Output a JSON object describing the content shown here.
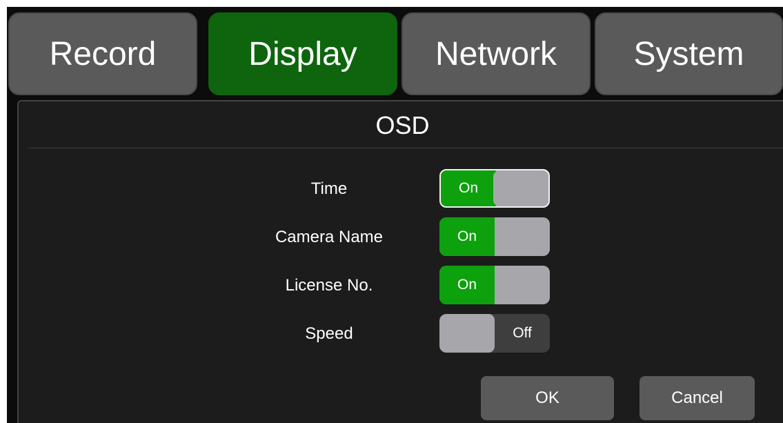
{
  "tabs": [
    {
      "label": "Record",
      "active": false
    },
    {
      "label": "Display",
      "active": true
    },
    {
      "label": "Network",
      "active": false
    },
    {
      "label": "System",
      "active": false
    }
  ],
  "panel": {
    "title": "OSD",
    "rows": [
      {
        "label": "Time",
        "state": "On",
        "selected": true
      },
      {
        "label": "Camera Name",
        "state": "On",
        "selected": false
      },
      {
        "label": "License No.",
        "state": "On",
        "selected": false
      },
      {
        "label": "Speed",
        "state": "Off",
        "selected": false
      }
    ]
  },
  "buttons": {
    "ok": "OK",
    "cancel": "Cancel"
  },
  "colors": {
    "active_tab": "#0e650e",
    "toggle_on": "#0ea10e",
    "toggle_knob": "#a7a6ab",
    "tab_inactive": "#5a5a5a"
  }
}
